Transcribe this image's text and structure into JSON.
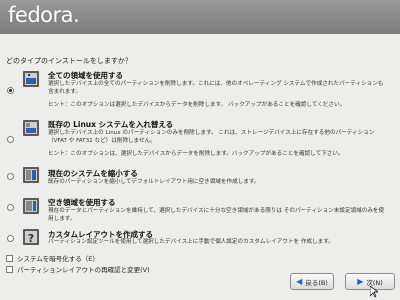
{
  "header": {
    "logo_text": "fedora."
  },
  "prompt": "どのタイプのインストールをしますか？",
  "options": [
    {
      "title": "全ての領域を使用する",
      "desc": "選択したデバイス上の全てのパーティションを削除します。これには、他のオペレーティング システムで作成されたパーティションも含まれます。",
      "hint": "ヒント：このオプションは選択したデバイスからデータを削除します。 バックアップがあることを確認してください。",
      "selected": true,
      "icon": "drive-replace-all-icon"
    },
    {
      "title": "既存の Linux システムを入れ替える",
      "desc": "選択したデバイス上の Linux のパーティションのみを削除します。 これは、ストレージデバイス上に存在する他のパーティション（VFAT や FAT32 など）は削除しません。",
      "hint": "ヒント：このオプションは、選択したデバイスからデータを削除します。バックアップがあることを確認して下さい。",
      "selected": false,
      "icon": "drive-replace-linux-icon"
    },
    {
      "title": "現在のシステムを縮小する",
      "desc": "既存のパーティションを縮小してデフォルトレイアウト用に空き領域を作成します。",
      "selected": false,
      "icon": "drive-shrink-icon"
    },
    {
      "title": "空き領域を使用する",
      "desc": "現在のデータとパーティションを維持して、選択したデバイスに十分な空き領域がある限りは そのパーティション未設定領域のみを使用します。",
      "selected": false,
      "icon": "drive-free-space-icon"
    },
    {
      "title": "カスタムレイアウトを作成する",
      "desc": "パーティション設定ツールを使用して選択したデバイス上に手動で個人設定のカスタムレイアウトを 作成します。",
      "selected": false,
      "icon": "custom-layout-icon"
    }
  ],
  "checkboxes": [
    {
      "label": "システムを暗号化する（E）",
      "checked": false
    },
    {
      "label": "パーティションレイアウトの再確認と変更(V)",
      "checked": false
    }
  ],
  "buttons": {
    "back": {
      "label": "戻る(B)",
      "icon": "back-arrow-icon"
    },
    "next": {
      "label": "次(N)",
      "icon": "next-arrow-icon"
    }
  },
  "colors": {
    "header": "#8a8a8a",
    "background": "#ededeb",
    "arrow": "#2e5fb0"
  }
}
